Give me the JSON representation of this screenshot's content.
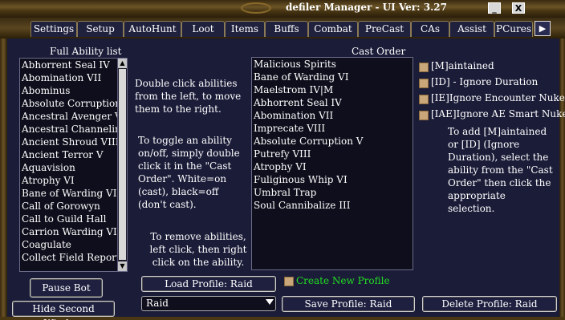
{
  "window": {
    "title": "defiler Manager  - UI Ver: 3.27",
    "minimize_glyph": "_",
    "close_glyph": "X"
  },
  "tabs": [
    {
      "label": "Settings"
    },
    {
      "label": "Setup"
    },
    {
      "label": "AutoHunt"
    },
    {
      "label": "Loot"
    },
    {
      "label": "Items"
    },
    {
      "label": "Buffs"
    },
    {
      "label": "Combat"
    },
    {
      "label": "PreCast"
    },
    {
      "label": "CAs"
    },
    {
      "label": "Assist"
    },
    {
      "label": "PCures"
    }
  ],
  "tab_scroll_icon": "right-arrow-icon",
  "full_ability_list": {
    "header": "Full Ability list",
    "items": [
      "Abhorrent Seal IV",
      "Abomination VII",
      "Abominus",
      "Absolute Corruption V",
      "Ancestral Avenger V",
      "Ancestral Channeling",
      "Ancient Shroud VIII",
      "Ancient Terror V",
      "Aquavision",
      "Atrophy VI",
      "Bane of Warding VI",
      "Call of Gorowyn",
      "Call to Guild Hall",
      "Carrion Warding VII",
      "Coagulate",
      "Collect Field Reports"
    ]
  },
  "instructions": {
    "move": "Double click abilities from the left, to move them to the right.",
    "toggle": "To toggle an ability on/off, simply double click it in the \"Cast Order\". White=on (cast), black=off (don't cast).",
    "remove": "To remove abilities, left click, then right click on the ability.",
    "add": "To add [M]aintained or [ID] (Ignore Duration), select the ability from the \"Cast Order\" then click the appropriate selection."
  },
  "cast_order": {
    "header": "Cast Order",
    "items": [
      "Malicious Spirits",
      "Bane of Warding VI",
      "Maelstrom IV|M",
      "Abhorrent Seal IV",
      "Abomination VII",
      "Imprecate VIII",
      "Absolute Corruption V",
      "Putrefy VIII",
      "Atrophy VI",
      "Fuliginous Whip VI",
      "Umbral Trap",
      "Soul Cannibalize III"
    ]
  },
  "options": {
    "maintained": "[M]aintained",
    "ignore_duration": "[ID] - Ignore Duration",
    "ignore_encounter": "[IE]Ignore Encounter Nukes",
    "ignore_ae": "[IAE]Ignore AE Smart Nukes"
  },
  "buttons": {
    "pause_bot": "Pause Bot",
    "hide_second_window": "Hide Second Window",
    "load_profile": "Load Profile: Raid",
    "save_profile": "Save Profile: Raid",
    "delete_profile": "Delete Profile: Raid"
  },
  "create_new_profile": {
    "label": "Create New Profile",
    "color": "#22dd22"
  },
  "profile_select": {
    "value": "Raid"
  },
  "colors": {
    "background": "#1b1c38",
    "frame": "#6b5426",
    "checkbox": "#c9a77a"
  }
}
